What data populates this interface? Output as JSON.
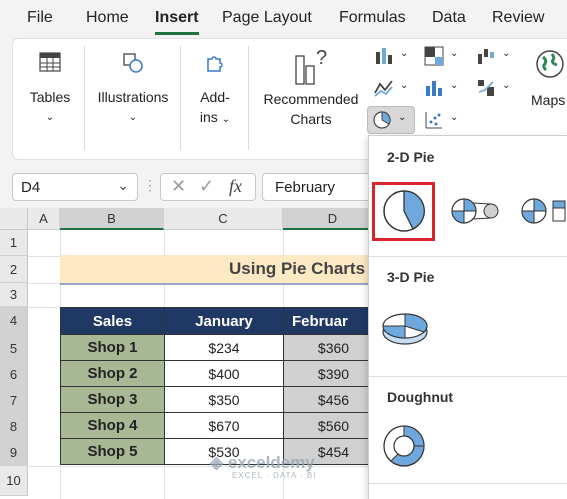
{
  "menu": {
    "tabs": [
      "File",
      "Home",
      "Insert",
      "Page Layout",
      "Formulas",
      "Data",
      "Review"
    ]
  },
  "ribbon": {
    "tables": "Tables",
    "illustrations": "Illustrations",
    "addins_line1": "Add-",
    "addins_line2": "ins",
    "recommended_line1": "Recommended",
    "recommended_line2": "Charts",
    "maps": "Maps"
  },
  "namebox": {
    "value": "D4"
  },
  "fx_label": "fx",
  "formula_bar": {
    "value": "February"
  },
  "columns": [
    "A",
    "B",
    "C",
    "D"
  ],
  "rows": [
    "1",
    "2",
    "3",
    "4",
    "5",
    "6",
    "7",
    "8",
    "9",
    "10"
  ],
  "sheet_title": "Using Pie Charts",
  "table": {
    "headers": [
      "Sales",
      "January",
      "Februar"
    ],
    "rows": [
      {
        "shop": "Shop 1",
        "jan": "$234",
        "feb": "$360"
      },
      {
        "shop": "Shop 2",
        "jan": "$400",
        "feb": "$390"
      },
      {
        "shop": "Shop 3",
        "jan": "$350",
        "feb": "$456"
      },
      {
        "shop": "Shop 4",
        "jan": "$670",
        "feb": "$560"
      },
      {
        "shop": "Shop 5",
        "jan": "$530",
        "feb": "$454"
      }
    ]
  },
  "dropdown": {
    "section_2d": "2-D Pie",
    "section_3d": "3-D Pie",
    "section_doughnut": "Doughnut"
  },
  "watermark": {
    "name": "exceldemy",
    "tagline": "EXCEL · DATA · BI"
  },
  "colors": {
    "accent": "#217346",
    "header_fill": "#1f3864",
    "shop_fill": "#a9b894",
    "highlight": "#d9262e",
    "pie_blue": "#6fa8dc"
  }
}
